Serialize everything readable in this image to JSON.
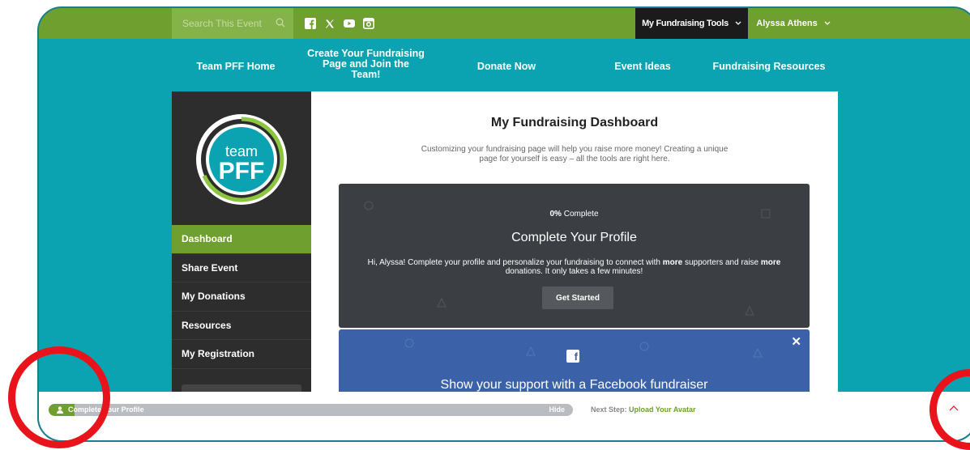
{
  "search": {
    "placeholder": "Search This Event"
  },
  "social_icons": [
    "facebook-icon",
    "x-icon",
    "youtube-icon",
    "instagram-icon"
  ],
  "topbar": {
    "tools_label": "My Fundraising Tools",
    "user_name": "Alyssa Athens"
  },
  "nav": [
    {
      "label": "Team PFF Home"
    },
    {
      "label": "Create Your Fundraising Page and Join the Team!"
    },
    {
      "label": "Donate Now"
    },
    {
      "label": "Event Ideas"
    },
    {
      "label": "Fundraising Resources"
    }
  ],
  "logo": {
    "text_top": "team",
    "text_bottom": "PFF"
  },
  "sidebar": {
    "items": [
      {
        "label": "Dashboard",
        "active": true
      },
      {
        "label": "Share Event"
      },
      {
        "label": "My Donations"
      },
      {
        "label": "Resources"
      },
      {
        "label": "My Registration"
      }
    ]
  },
  "main": {
    "title": "My Fundraising Dashboard",
    "description": "Customizing your fundraising page will help you raise more money! Creating a unique page for yourself is easy – all the tools are right here."
  },
  "profile_card": {
    "percent": "0%",
    "percent_suffix": " Complete",
    "title": "Complete Your Profile",
    "message_part1": "Hi, Alyssa! Complete your profile and personalize your fundraising to connect with ",
    "bold1": "more",
    "message_part2": " supporters and raise ",
    "bold2": "more",
    "message_part3": " donations. It only takes a few minutes!",
    "button": "Get Started"
  },
  "fb_card": {
    "title": "Show your support with a Facebook fundraiser",
    "close": "✕"
  },
  "bottom": {
    "progress_label": "Complete Your Profile",
    "progress_fraction": 0.05,
    "hide_label": "Hide",
    "next_step_prefix": "Next Step: ",
    "next_step_value": "Upload Your Avatar"
  },
  "colors": {
    "teal": "#0ba3b1",
    "green": "#6f9f2e",
    "dark": "#2d2d2d",
    "fb_blue": "#3b62a9",
    "highlight_red": "#e8131b"
  }
}
